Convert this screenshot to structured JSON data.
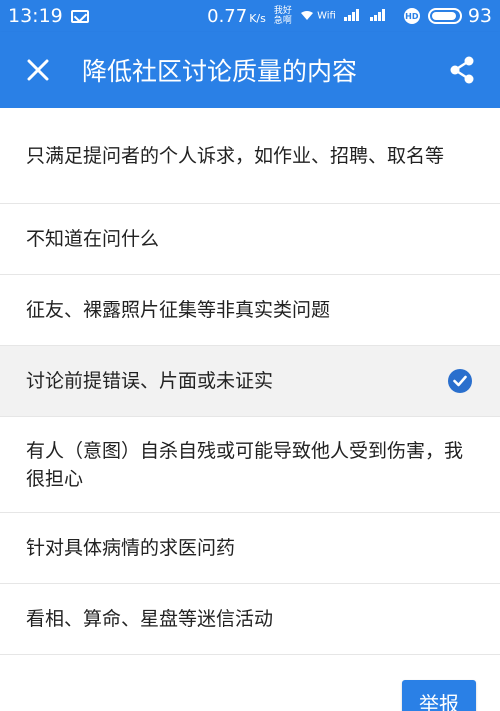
{
  "status_bar": {
    "time": "13:19",
    "net_speed": "0.77",
    "net_speed_unit": "K/s",
    "small_label_top": "我好",
    "small_label_bottom": "急啊",
    "wifi_label": "Wifi",
    "battery_level": "93",
    "battery_fraction": 0.93
  },
  "app_bar": {
    "title": "降低社区讨论质量的内容",
    "close_icon": "close-icon",
    "share_icon": "share-icon"
  },
  "items": [
    {
      "label": "只满足提问者的个人诉求，如作业、招聘、取名等",
      "selected": false
    },
    {
      "label": "不知道在问什么",
      "selected": false
    },
    {
      "label": "征友、裸露照片征集等非真实类问题",
      "selected": false
    },
    {
      "label": "讨论前提错误、片面或未证实",
      "selected": true
    },
    {
      "label": "有人（意图）自杀自残或可能导致他人受到伤害，我很担心",
      "selected": false
    },
    {
      "label": "针对具体病情的求医问药",
      "selected": false
    },
    {
      "label": "看相、算命、星盘等迷信活动",
      "selected": false
    }
  ],
  "report_button": {
    "label": "举报"
  },
  "colors": {
    "primary": "#2a80e6",
    "check": "#2a6fcd",
    "selected_row": "#f2f2f2"
  }
}
